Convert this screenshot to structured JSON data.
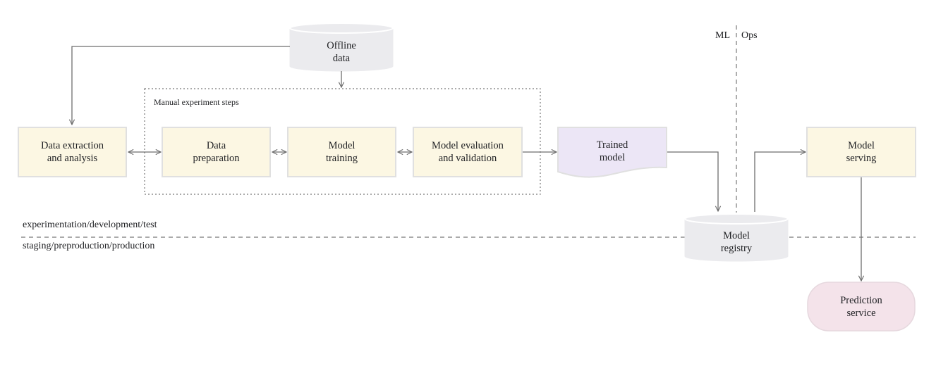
{
  "colors": {
    "process_fill": "#fcf7e3",
    "process_stroke": "#e0e0e0",
    "store_fill": "#ebebee",
    "artifact_fill": "#ece6f6",
    "service_fill": "#f4e3ea",
    "line": "#6e6e6e"
  },
  "nodes": {
    "offline_data": "Offline\ndata",
    "data_extraction": "Data extraction\nand analysis",
    "data_preparation": "Data\npreparation",
    "model_training": "Model\ntraining",
    "model_evaluation": "Model evaluation\nand validation",
    "trained_model": "Trained\nmodel",
    "model_registry": "Model\nregistry",
    "model_serving": "Model\nserving",
    "prediction_service": "Prediction\nservice"
  },
  "groups": {
    "manual_steps": "Manual experiment steps"
  },
  "zones": {
    "ml": "ML",
    "ops": "Ops",
    "upper_env": "experimentation/development/test",
    "lower_env": "staging/preproduction/production"
  }
}
